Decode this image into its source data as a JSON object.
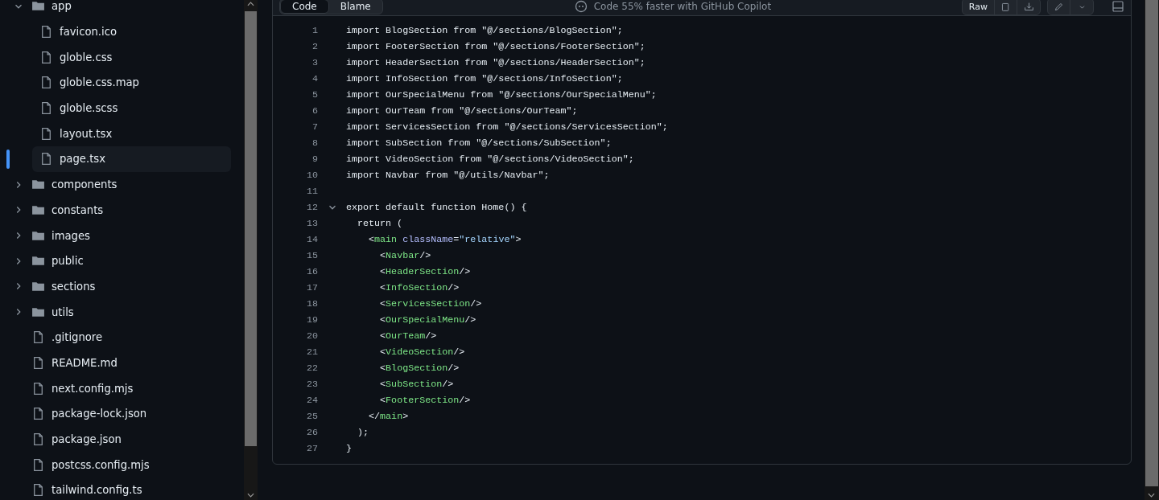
{
  "file_tree": [
    {
      "kind": "folder",
      "name": "app",
      "expanded": true,
      "selected": false,
      "children": [
        {
          "kind": "file",
          "name": "favicon.ico",
          "selected": false
        },
        {
          "kind": "file",
          "name": "globle.css",
          "selected": false
        },
        {
          "kind": "file",
          "name": "globle.css.map",
          "selected": false
        },
        {
          "kind": "file",
          "name": "globle.scss",
          "selected": false
        },
        {
          "kind": "file",
          "name": "layout.tsx",
          "selected": false
        },
        {
          "kind": "file",
          "name": "page.tsx",
          "selected": true
        }
      ]
    },
    {
      "kind": "folder",
      "name": "components",
      "expanded": false,
      "selected": false
    },
    {
      "kind": "folder",
      "name": "constants",
      "expanded": false,
      "selected": false
    },
    {
      "kind": "folder",
      "name": "images",
      "expanded": false,
      "selected": false
    },
    {
      "kind": "folder",
      "name": "public",
      "expanded": false,
      "selected": false
    },
    {
      "kind": "folder",
      "name": "sections",
      "expanded": false,
      "selected": false
    },
    {
      "kind": "folder",
      "name": "utils",
      "expanded": false,
      "selected": false
    },
    {
      "kind": "file",
      "name": ".gitignore",
      "selected": false
    },
    {
      "kind": "file",
      "name": "README.md",
      "selected": false
    },
    {
      "kind": "file",
      "name": "next.config.mjs",
      "selected": false
    },
    {
      "kind": "file",
      "name": "package-lock.json",
      "selected": false
    },
    {
      "kind": "file",
      "name": "package.json",
      "selected": false
    },
    {
      "kind": "file",
      "name": "postcss.config.mjs",
      "selected": false
    },
    {
      "kind": "file",
      "name": "tailwind.config.ts",
      "selected": false
    }
  ],
  "toolbar": {
    "tabs": [
      {
        "label": "Code",
        "selected": true
      },
      {
        "label": "Blame",
        "selected": false
      }
    ],
    "copilot_text": "Code 55% faster with GitHub Copilot",
    "raw_button": "Raw"
  },
  "code_lines": [
    {
      "number": "1",
      "tokens": [
        {
          "kind": "plain",
          "text": "import BlogSection from \"@/sections/BlogSection\";"
        }
      ]
    },
    {
      "number": "2",
      "tokens": [
        {
          "kind": "plain",
          "text": "import FooterSection from \"@/sections/FooterSection\";"
        }
      ]
    },
    {
      "number": "3",
      "tokens": [
        {
          "kind": "plain",
          "text": "import HeaderSection from \"@/sections/HeaderSection\";"
        }
      ]
    },
    {
      "number": "4",
      "tokens": [
        {
          "kind": "plain",
          "text": "import InfoSection from \"@/sections/InfoSection\";"
        }
      ]
    },
    {
      "number": "5",
      "tokens": [
        {
          "kind": "plain",
          "text": "import OurSpecialMenu from \"@/sections/OurSpecialMenu\";"
        }
      ]
    },
    {
      "number": "6",
      "tokens": [
        {
          "kind": "plain",
          "text": "import OurTeam from \"@/sections/OurTeam\";"
        }
      ]
    },
    {
      "number": "7",
      "tokens": [
        {
          "kind": "plain",
          "text": "import ServicesSection from \"@/sections/ServicesSection\";"
        }
      ]
    },
    {
      "number": "8",
      "tokens": [
        {
          "kind": "plain",
          "text": "import SubSection from \"@/sections/SubSection\";"
        }
      ]
    },
    {
      "number": "9",
      "tokens": [
        {
          "kind": "plain",
          "text": "import VideoSection from \"@/sections/VideoSection\";"
        }
      ]
    },
    {
      "number": "10",
      "tokens": [
        {
          "kind": "plain",
          "text": "import Navbar from \"@/utils/Navbar\";"
        }
      ]
    },
    {
      "number": "11"
    },
    {
      "number": "12",
      "foldable": true,
      "tokens": [
        {
          "kind": "plain",
          "text": "export default function Home() {"
        }
      ]
    },
    {
      "number": "13",
      "tokens": [
        {
          "kind": "plain",
          "text": "  return ("
        }
      ]
    },
    {
      "number": "14",
      "tokens": [
        {
          "kind": "plain",
          "text": "    <"
        },
        {
          "kind": "tag",
          "text": "main"
        },
        {
          "kind": "attr",
          "text": " className"
        },
        {
          "kind": "plain",
          "text": "="
        },
        {
          "kind": "str",
          "text": "\"relative\""
        },
        {
          "kind": "plain",
          "text": ">"
        }
      ]
    },
    {
      "number": "15",
      "tokens": [
        {
          "kind": "plain",
          "text": "      <"
        },
        {
          "kind": "tag",
          "text": "Navbar"
        },
        {
          "kind": "plain",
          "text": "/>"
        }
      ]
    },
    {
      "number": "16",
      "tokens": [
        {
          "kind": "plain",
          "text": "      <"
        },
        {
          "kind": "tag",
          "text": "HeaderSection"
        },
        {
          "kind": "plain",
          "text": "/>"
        }
      ]
    },
    {
      "number": "17",
      "tokens": [
        {
          "kind": "plain",
          "text": "      <"
        },
        {
          "kind": "tag",
          "text": "InfoSection"
        },
        {
          "kind": "plain",
          "text": "/>"
        }
      ]
    },
    {
      "number": "18",
      "tokens": [
        {
          "kind": "plain",
          "text": "      <"
        },
        {
          "kind": "tag",
          "text": "ServicesSection"
        },
        {
          "kind": "plain",
          "text": "/>"
        }
      ]
    },
    {
      "number": "19",
      "tokens": [
        {
          "kind": "plain",
          "text": "      <"
        },
        {
          "kind": "tag",
          "text": "OurSpecialMenu"
        },
        {
          "kind": "plain",
          "text": "/>"
        }
      ]
    },
    {
      "number": "20",
      "tokens": [
        {
          "kind": "plain",
          "text": "      <"
        },
        {
          "kind": "tag",
          "text": "OurTeam"
        },
        {
          "kind": "plain",
          "text": "/>"
        }
      ]
    },
    {
      "number": "21",
      "tokens": [
        {
          "kind": "plain",
          "text": "      <"
        },
        {
          "kind": "tag",
          "text": "VideoSection"
        },
        {
          "kind": "plain",
          "text": "/>"
        }
      ]
    },
    {
      "number": "22",
      "tokens": [
        {
          "kind": "plain",
          "text": "      <"
        },
        {
          "kind": "tag",
          "text": "BlogSection"
        },
        {
          "kind": "plain",
          "text": "/>"
        }
      ]
    },
    {
      "number": "23",
      "tokens": [
        {
          "kind": "plain",
          "text": "      <"
        },
        {
          "kind": "tag",
          "text": "SubSection"
        },
        {
          "kind": "plain",
          "text": "/>"
        }
      ]
    },
    {
      "number": "24",
      "tokens": [
        {
          "kind": "plain",
          "text": "      <"
        },
        {
          "kind": "tag",
          "text": "FooterSection"
        },
        {
          "kind": "plain",
          "text": "/>"
        }
      ]
    },
    {
      "number": "25",
      "tokens": [
        {
          "kind": "plain",
          "text": "    </"
        },
        {
          "kind": "tag",
          "text": "main"
        },
        {
          "kind": "plain",
          "text": ">"
        }
      ]
    },
    {
      "number": "26",
      "tokens": [
        {
          "kind": "plain",
          "text": "  );"
        }
      ]
    },
    {
      "number": "27",
      "tokens": [
        {
          "kind": "plain",
          "text": "}"
        }
      ]
    }
  ]
}
